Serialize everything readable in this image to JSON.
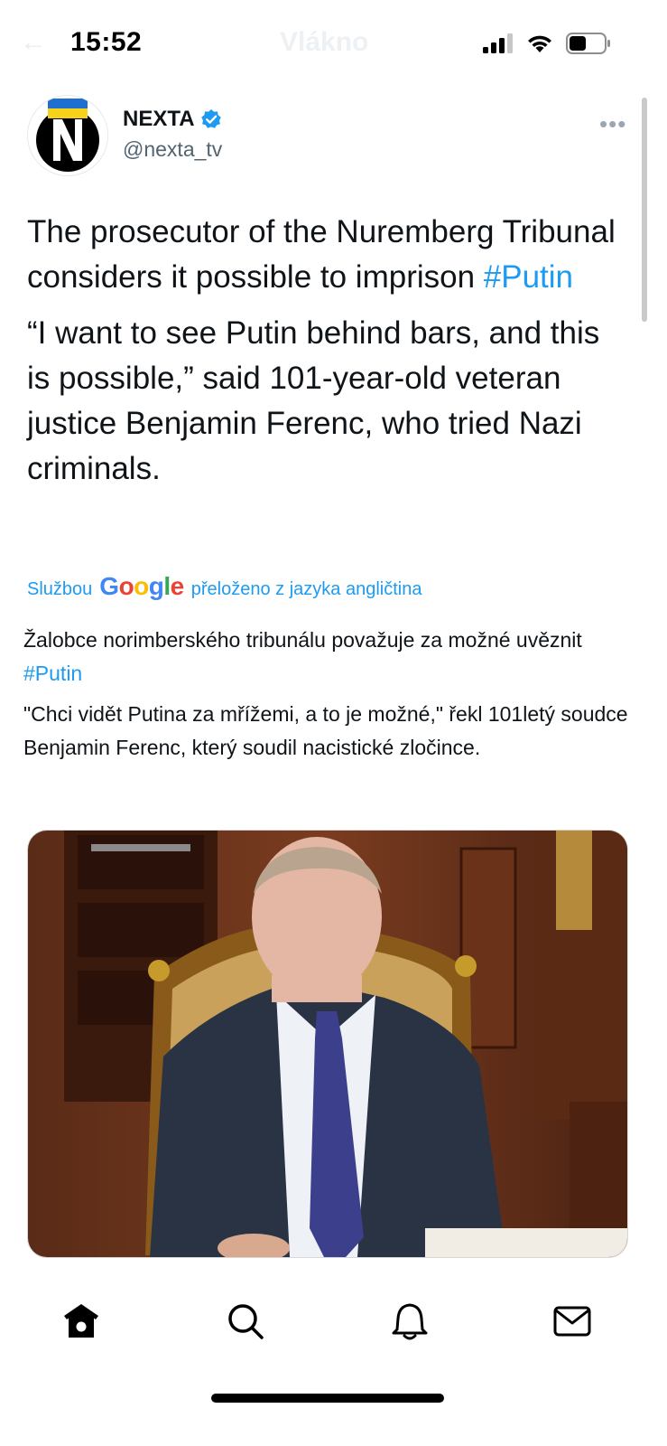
{
  "status_bar": {
    "time": "15:52",
    "ghost_back": "←",
    "ghost_title": "Vlákno",
    "icons": [
      "cellular-signal-icon",
      "wifi-icon",
      "battery-icon"
    ]
  },
  "tweet": {
    "author": {
      "name": "NEXTA",
      "handle": "@nexta_tv",
      "verified": true
    },
    "more_label": "•••",
    "original_paragraph_1": "The prosecutor of the Nuremberg Tribunal considers it possible to imprison ",
    "original_hashtag": "#Putin",
    "original_paragraph_2": " “I want to see Putin behind bars, and this is possible,” said 101-year-old veteran justice Benjamin Ferenc, who tried Nazi criminals.",
    "translation": {
      "prefix": "Službou",
      "provider": "Google",
      "suffix": "přeloženo z jazyka angličtina",
      "paragraph_1": "Žalobce norimberského tribunálu považuje za možné uvěznit ",
      "hashtag": "#Putin",
      "paragraph_2": " \"Chci vidět Putina za mřížemi, a to je možné,\" řekl 101letý soudce Benjamin Ferenc, který soudil nacistické zločince."
    },
    "media_alt": "photo"
  },
  "tabbar": {
    "items": [
      "home-icon",
      "search-icon",
      "notifications-icon",
      "messages-icon"
    ]
  },
  "colors": {
    "accent": "#1d9bf0",
    "text": "#0f1419",
    "secondary": "#536471"
  }
}
